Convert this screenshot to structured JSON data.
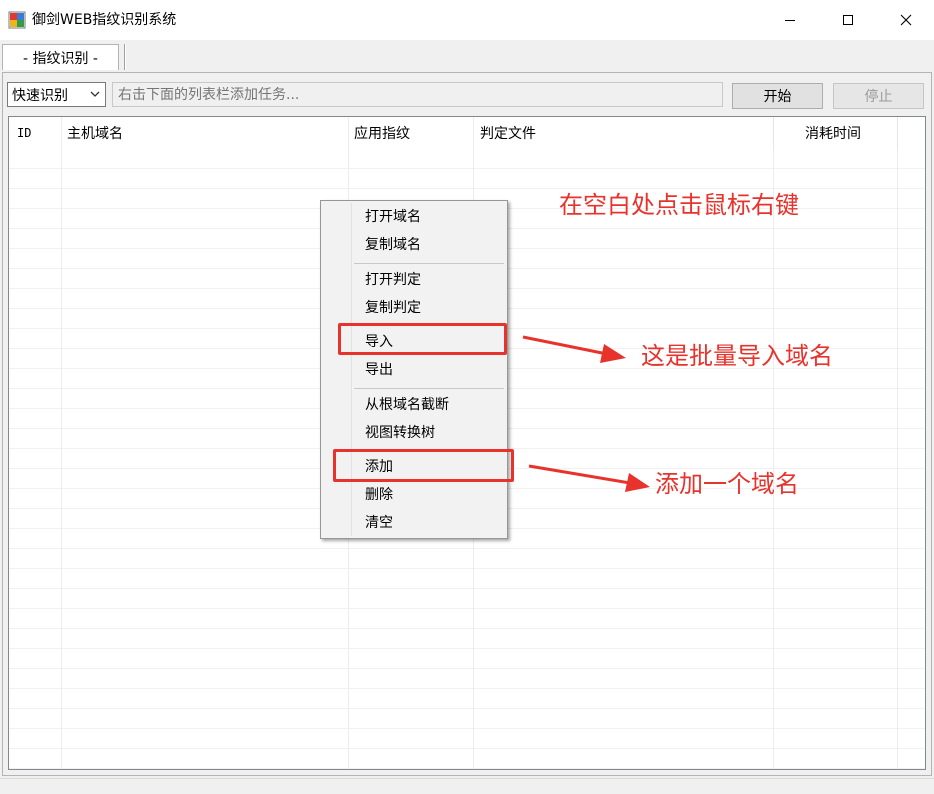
{
  "window": {
    "title": "御剑WEB指纹识别系统",
    "controls": {
      "minimize": "—",
      "maximize": "☐",
      "close": "✕"
    }
  },
  "tabs": [
    {
      "label": "- 指纹识别 -",
      "active": true
    }
  ],
  "toolbar": {
    "mode_select": {
      "value": "快速识别"
    },
    "task_input": {
      "placeholder": "右击下面的列表栏添加任务...",
      "value": ""
    },
    "start_label": "开始",
    "stop_label": "停止"
  },
  "table": {
    "columns": [
      "ID",
      "主机域名",
      "应用指纹",
      "判定文件",
      "消耗时间"
    ],
    "rows": []
  },
  "context_menu": {
    "groups": [
      [
        "打开域名",
        "复制域名"
      ],
      [
        "打开判定",
        "复制判定"
      ],
      [
        "导入",
        "导出"
      ],
      [
        "从根域名截断",
        "视图转换树"
      ],
      [
        "添加",
        "删除",
        "清空"
      ]
    ]
  },
  "annotations": {
    "right_click_hint": "在空白处点击鼠标右键",
    "import_note": "这是批量导入域名",
    "add_note": "添加一个域名",
    "color": "#e8322c"
  },
  "icons": [
    "app-icon",
    "chevron-down-icon",
    "minimize-icon",
    "maximize-icon",
    "close-icon",
    "arrow-icon"
  ]
}
